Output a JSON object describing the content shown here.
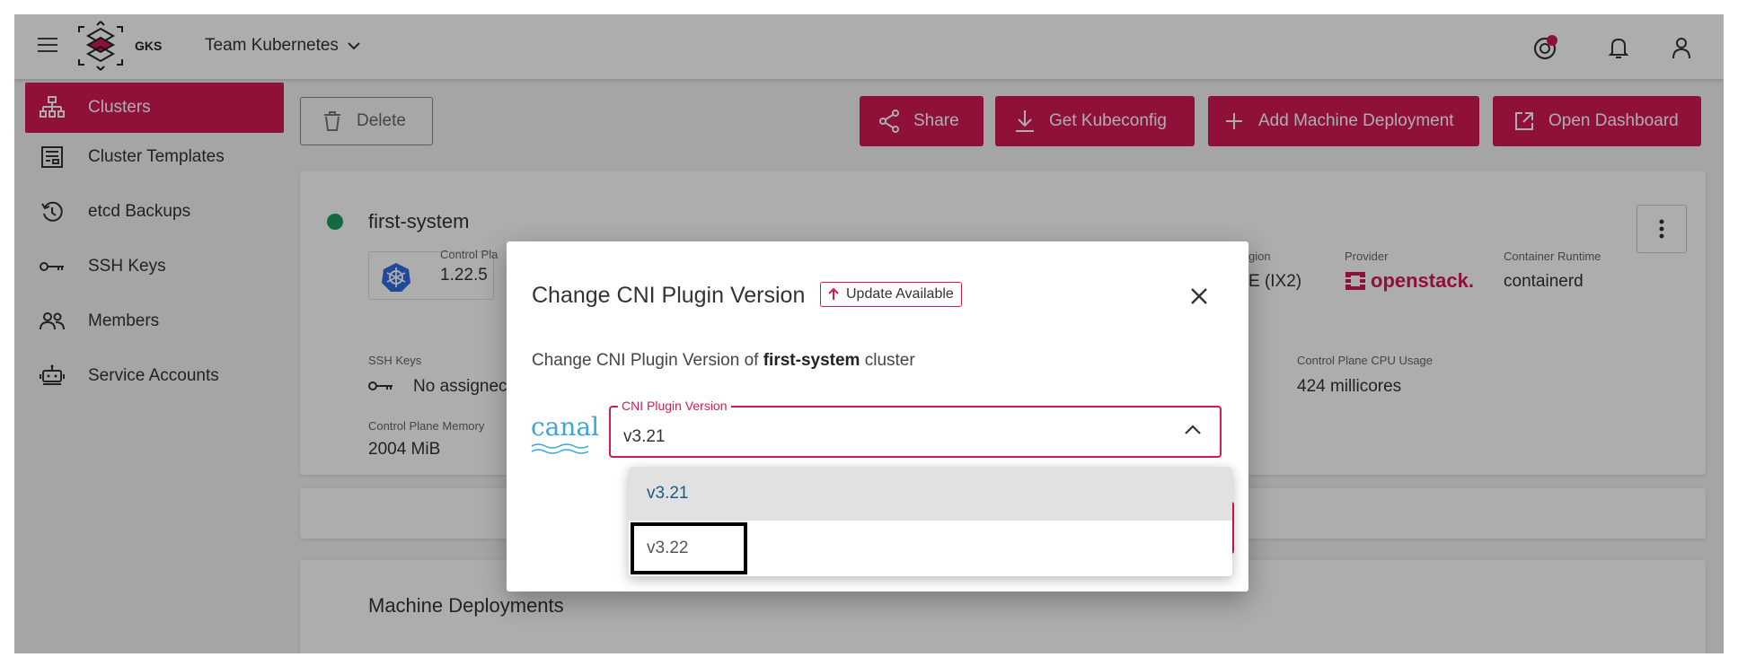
{
  "header": {
    "logo_text": "GKS",
    "team_name": "Team Kubernetes"
  },
  "sidebar": {
    "items": [
      {
        "label": "Clusters",
        "icon": "sitemap-icon",
        "active": true
      },
      {
        "label": "Cluster Templates",
        "icon": "template-icon"
      },
      {
        "label": "etcd Backups",
        "icon": "history-icon"
      },
      {
        "label": "SSH Keys",
        "icon": "key-icon"
      },
      {
        "label": "Members",
        "icon": "people-icon"
      },
      {
        "label": "Service Accounts",
        "icon": "robot-icon"
      }
    ]
  },
  "toolbar": {
    "delete_label": "Delete",
    "share_label": "Share",
    "kubeconfig_label": "Get Kubeconfig",
    "add_md_label": "Add Machine Deployment",
    "dashboard_label": "Open Dashboard"
  },
  "cluster": {
    "name": "first-system",
    "status_color": "#1b9e5f",
    "control_plane_label": "Control Pla",
    "version": "1.22.5",
    "region_label": "gion",
    "region_value": "E (IX2)",
    "provider_label": "Provider",
    "provider_value": "openstack.",
    "runtime_label": "Container Runtime",
    "runtime_value": "containerd",
    "ssh_label": "SSH Keys",
    "ssh_value": "No assignec",
    "cpu_label": "Control Plane CPU Usage",
    "cpu_value": "424 millicores",
    "memory_label": "Control Plane Memory",
    "memory_value": "2004 MiB"
  },
  "machine_deployments": {
    "title": "Machine Deployments"
  },
  "dialog": {
    "title": "Change CNI Plugin Version",
    "badge": "Update Available",
    "desc_prefix": "Change CNI Plugin Version of ",
    "desc_cluster": "first-system",
    "desc_suffix": " cluster",
    "canal_logo_text": "canal",
    "field_label": "CNI Plugin Version",
    "field_value": "v3.21",
    "options": [
      "v3.21",
      "v3.22"
    ]
  },
  "colors": {
    "accent": "#d41a52",
    "selected_option_text": "#1c5a86",
    "canal_blue": "#3da5d9"
  }
}
